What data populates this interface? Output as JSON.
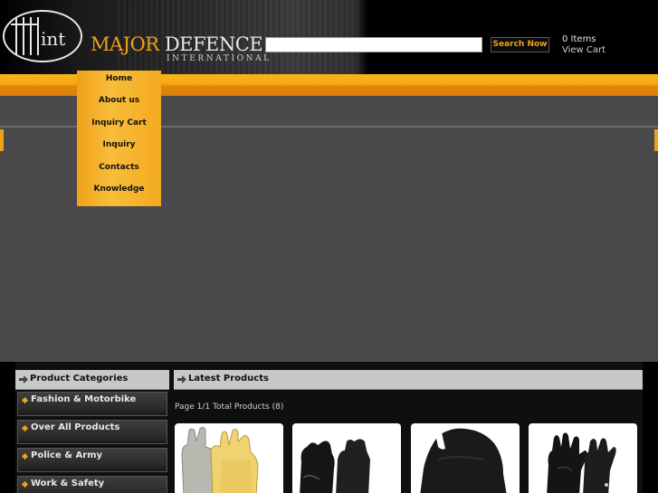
{
  "header": {
    "brand_first": "MAJOR",
    "brand_second": "DEFENCE",
    "brand_sub": "INTERNATIONAL",
    "logo_text": "int",
    "search": {
      "value": "",
      "button_label": "Search Now"
    },
    "cart": {
      "items_label": "0 Items",
      "view_label": "View Cart"
    }
  },
  "menu": {
    "items": [
      "Home",
      "About us",
      "Inquiry Cart",
      "Inquiry",
      "Contacts",
      "Knowledge"
    ]
  },
  "categories": {
    "title": "Product Categories",
    "items": [
      "Fashion & Motorbike",
      "Over All Products",
      "Police & Army",
      "Work & Safety"
    ]
  },
  "latest": {
    "title": "Latest Products",
    "paging": "Page  1/1   Total Products (8)"
  },
  "products": [
    {
      "icon": "yellow-gloves-image"
    },
    {
      "icon": "black-gloves-image"
    },
    {
      "icon": "balaclava-image"
    },
    {
      "icon": "leather-gloves-image"
    }
  ],
  "colors": {
    "accent": "#f0a11b",
    "gray_area": "#4a494b",
    "header_bar": "#c8c8c8"
  }
}
